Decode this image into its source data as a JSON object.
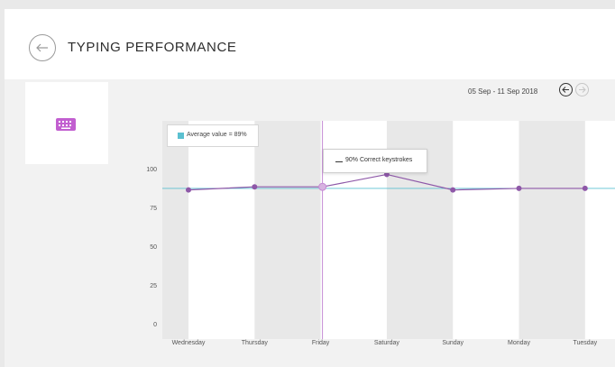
{
  "header": {
    "title": "TYPING PERFORMANCE",
    "back_icon": "arrow-left-icon"
  },
  "tile": {
    "icon": "keyboard-icon",
    "icon_color": "#c25fd0"
  },
  "date_nav": {
    "range_label": "05 Sep - 11 Sep 2018",
    "prev_icon": "arrow-left-icon",
    "next_icon": "arrow-right-icon"
  },
  "legend": {
    "label": "Average value = 89%",
    "color": "#5bc0d0"
  },
  "tooltip": {
    "label": "90% Correct keystrokes"
  },
  "colors": {
    "line": "#8e58a8",
    "average": "#5bc0d0",
    "cursor": "#c58ad5",
    "stripe": "#e8e8e8"
  },
  "chart_data": {
    "type": "line",
    "categories": [
      "Wednesday",
      "Thursday",
      "Friday",
      "Saturday",
      "Sunday",
      "Monday",
      "Tuesday"
    ],
    "series": [
      {
        "name": "Correct keystrokes",
        "values": [
          88,
          90,
          90,
          98,
          88,
          89,
          89
        ]
      }
    ],
    "average": 89,
    "yticks": [
      0,
      25,
      50,
      75,
      100
    ],
    "ylim": [
      0,
      100
    ],
    "highlighted_category": "Friday",
    "highlighted_value": "90%",
    "grid": false,
    "legend_position": "top-left"
  }
}
